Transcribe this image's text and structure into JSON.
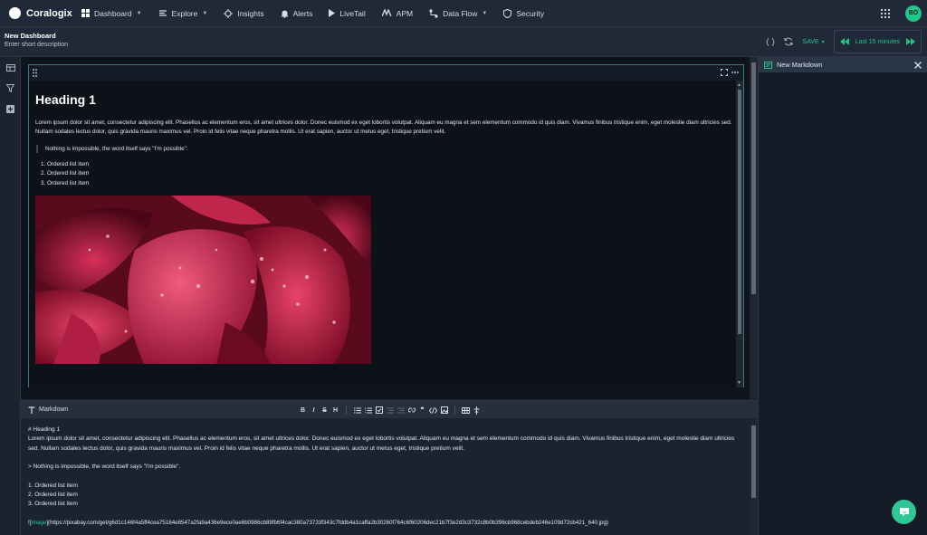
{
  "nav": {
    "brand": "Coralogix",
    "items": [
      {
        "label": "Dashboard",
        "icon": "grid-icon",
        "has_caret": true
      },
      {
        "label": "Explore",
        "icon": "explore-icon",
        "has_caret": true
      },
      {
        "label": "Insights",
        "icon": "insights-icon",
        "has_caret": false
      },
      {
        "label": "Alerts",
        "icon": "bell-icon",
        "has_caret": false
      },
      {
        "label": "LiveTail",
        "icon": "play-icon",
        "has_caret": false
      },
      {
        "label": "APM",
        "icon": "apm-icon",
        "has_caret": false
      },
      {
        "label": "Data Flow",
        "icon": "dataflow-icon",
        "has_caret": true
      },
      {
        "label": "Security",
        "icon": "shield-icon",
        "has_caret": false
      }
    ],
    "user_initials": "BO"
  },
  "dashboard": {
    "title": "New Dashboard",
    "description": "Enter short description",
    "save_label": "SAVE",
    "time_range": "Last 15 minutes"
  },
  "widget": {
    "heading": "Heading 1",
    "paragraph": "Lorem ipsum dolor sit amet, consectetur adipiscing elit. Phasellus ac elementum eros, sit amet ultrices dolor. Donec euismod ex eget lobortis volutpat. Aliquam eu magna et sem elementum commodo id quis diam. Vivamus finibus tristique enim, eget molestie diam ultricies sed. Nullam sodales lectus dolor, quis gravida mauris maximus vel. Proin id felis vitae neque pharetra mollis. Ut erat sapien, auctor ut metus eget, tristique pretium velit.",
    "quote": "Nothing is impossible, the word itself says \"I'm possible\".",
    "list": [
      "Ordered list item",
      "Ordered list item",
      "Ordered list item"
    ]
  },
  "editor": {
    "label": "Markdown",
    "lines": {
      "h1": "# Heading 1",
      "paragraph": "Lorem ipsum dolor sit amet, consectetur adipiscing elit. Phasellus ac elementum eros, sit amet ultrices dolor. Donec euismod ex eget lobortis volutpat. Aliquam eu magna et sem elementum commodo id quis diam. Vivamus finibus tristique enim, eget molestie diam ultricies sed. Nullam sodales lectus dolor, quis gravida mauris maximus vel. Proin id felis vitae neque pharetra mollis. Ut erat sapien, auctor ut metus eget, tristique pretium velit.",
      "quote": "> Nothing is impossible, the word itself says \"I'm possible\".",
      "list1": "1. Ordered list item",
      "list2": "2. Ordered list item",
      "list3": "3. Ordered list item",
      "img_prefix": "![",
      "img_alt": "image",
      "img_url": "](https://pixabay.com/get/g6d1c146f4a5ff4cea75184e6547a2fa9a436e9ece0ae6b0986cb89fb6f4cac380a73733f343c7fddb4a1caffa2b30260f764c6f60206dec21b7f3e2d3c3732c8b0b396cb968cebdeb246e109d72cb421_640.jpg)"
    }
  },
  "right_panel": {
    "title": "New Markdown"
  },
  "colors": {
    "accent": "#23c48a",
    "background": "#1b2331",
    "widget_border": "#2f7f73"
  }
}
